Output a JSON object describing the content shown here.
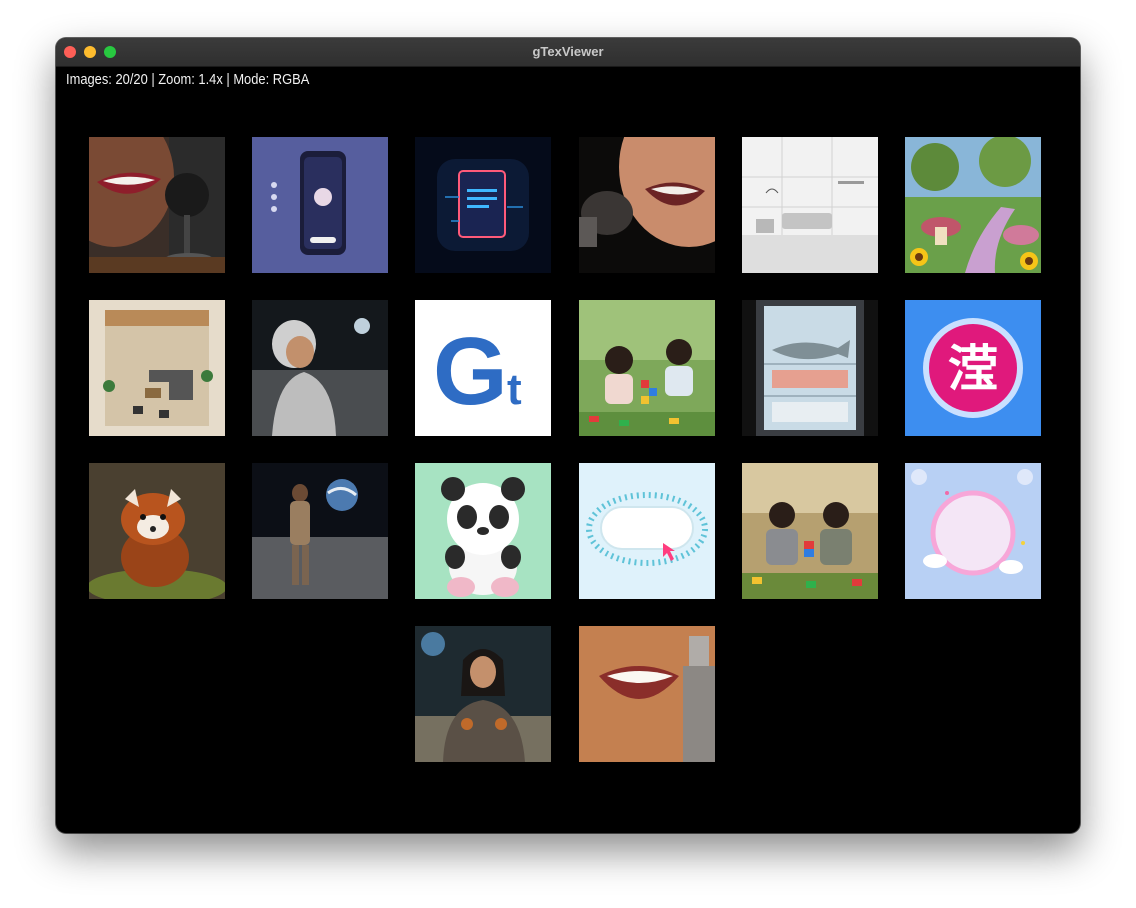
{
  "window": {
    "title": "gTexViewer"
  },
  "status_text": "Images: 20/20 | Zoom: 1.4x | Mode: RGBA",
  "gallery": {
    "images": [
      {
        "icon": "smiling-woman-microphone-image"
      },
      {
        "icon": "phone-app-mockup-image"
      },
      {
        "icon": "document-circuit-icon-image"
      },
      {
        "icon": "woman-singing-microphone-image"
      },
      {
        "icon": "minimal-living-room-sketch-image"
      },
      {
        "icon": "sunflower-mushroom-garden-image"
      },
      {
        "icon": "living-room-top-view-image"
      },
      {
        "icon": "astronaut-woman-moon-image"
      },
      {
        "icon": "gt-logo-image",
        "text": "G",
        "text2": "t"
      },
      {
        "icon": "children-playing-blocks-image"
      },
      {
        "icon": "fish-in-fridge-image"
      },
      {
        "icon": "kanji-badge-image",
        "text": "滢"
      },
      {
        "icon": "red-panda-image"
      },
      {
        "icon": "astronaut-moon-earth-image"
      },
      {
        "icon": "cartoon-panda-image"
      },
      {
        "icon": "dotted-button-cursor-image"
      },
      {
        "icon": "boys-playing-blocks-image"
      },
      {
        "icon": "pastel-circle-frame-image"
      },
      {
        "icon": "armored-woman-moon-image"
      },
      {
        "icon": "smile-microphone-closeup-image"
      }
    ]
  }
}
